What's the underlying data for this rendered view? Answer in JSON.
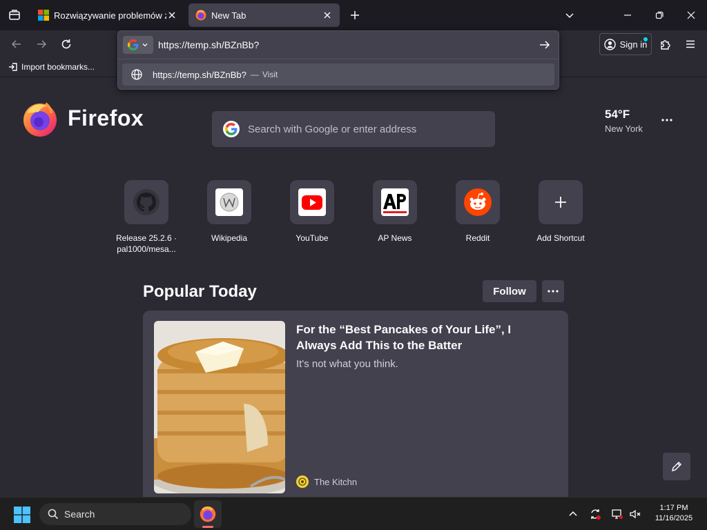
{
  "tabs": [
    {
      "title": "Rozwiązywanie problemów z dź",
      "active": false
    },
    {
      "title": "New Tab",
      "active": true
    }
  ],
  "urlbar": {
    "value": "https://temp.sh/BZnBb?",
    "suggestion_url": "https://temp.sh/BZnBb?",
    "suggestion_sep": "—",
    "suggestion_action": "Visit"
  },
  "toolbar": {
    "sign_in": "Sign in"
  },
  "bookmarks": {
    "import": "Import bookmarks..."
  },
  "brand": {
    "wordmark": "Firefox"
  },
  "search": {
    "placeholder": "Search with Google or enter address"
  },
  "weather": {
    "temp": "54°F",
    "city": "New York"
  },
  "shortcuts": [
    {
      "label": "Release 25.2.6 · pal1000/mesa...",
      "icon": "github-icon"
    },
    {
      "label": "Wikipedia",
      "icon": "wikipedia-icon"
    },
    {
      "label": "YouTube",
      "icon": "youtube-icon"
    },
    {
      "label": "AP News",
      "icon": "ap-news-icon"
    },
    {
      "label": "Reddit",
      "icon": "reddit-icon"
    },
    {
      "label": "Add Shortcut",
      "icon": "plus-icon"
    }
  ],
  "popular": {
    "title": "Popular Today",
    "follow": "Follow",
    "card": {
      "headline": "For the “Best Pancakes of Your Life”, I Always Add This to the Batter",
      "excerpt": "It's not what you think.",
      "source": "The Kitchn"
    }
  },
  "taskbar": {
    "search": "Search",
    "time": "1:17 PM",
    "date": "11/16/2025"
  },
  "colors": {
    "accent": "#00ddff",
    "bg": "#2b2a33",
    "card": "#42414d"
  }
}
